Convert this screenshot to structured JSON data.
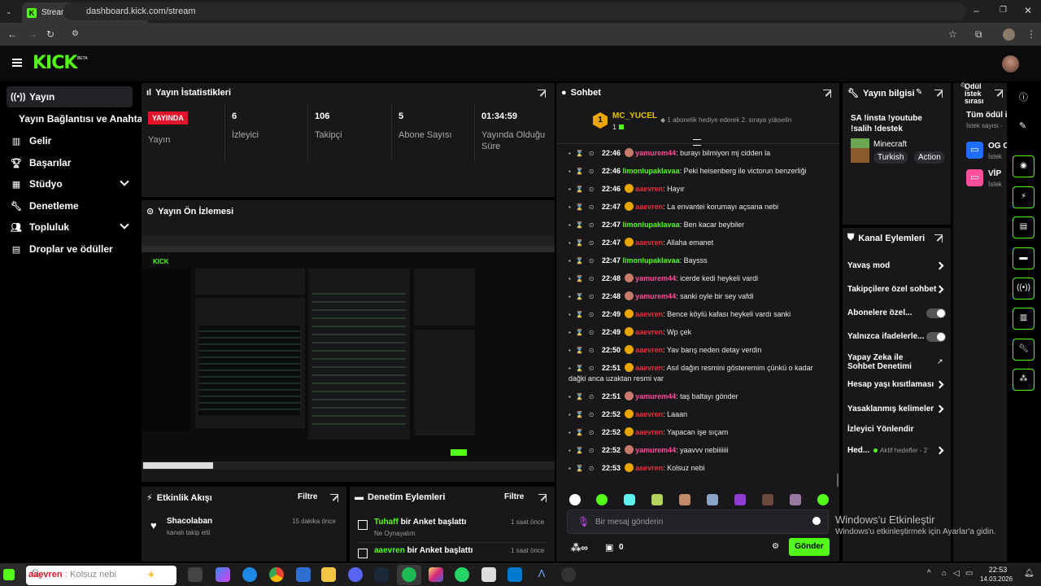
{
  "browser": {
    "tab_title": "Stream - Kick Dashboard",
    "url": "dashboard.kick.com/stream"
  },
  "header": {
    "logo": "KICK",
    "beta": "BETA"
  },
  "sidebar": {
    "items": [
      {
        "label": "Yayın",
        "icon": "broadcast-icon"
      },
      {
        "label": "Yayın Bağlantısı ve Anahtarı",
        "icon": ""
      },
      {
        "label": "Gelir",
        "icon": "chart-icon"
      },
      {
        "label": "Başarılar",
        "icon": "trophy-icon"
      },
      {
        "label": "Stüdyo",
        "icon": "studio-icon"
      },
      {
        "label": "Denetleme",
        "icon": "wrench-icon"
      },
      {
        "label": "Topluluk",
        "icon": "users-icon"
      },
      {
        "label": "Droplar ve ödüller",
        "icon": "gift-icon"
      }
    ]
  },
  "stats": {
    "title": "Yayın İstatistikleri",
    "live_badge": "YAYINDA",
    "live_label": "Yayın",
    "viewers_value": "6",
    "viewers_label": "İzleyici",
    "followers_value": "106",
    "followers_label": "Takipçi",
    "subs_value": "5",
    "subs_label": "Abone Sayısı",
    "uptime_value": "01:34:59",
    "uptime_label": "Yayında Olduğu Süre"
  },
  "preview": {
    "title": "Yayın Ön İzlemesi"
  },
  "activity": {
    "title": "Etkinlik Akışı",
    "filter": "Filtre",
    "item_user": "Shacolaban",
    "item_desc": "kanalı takip etti",
    "item_time": "15 dakika önce"
  },
  "moderation": {
    "title": "Denetim Eylemleri",
    "filter": "Filtre",
    "items": [
      {
        "user": "Tuhaff",
        "action": " bir Anket başlattı",
        "sub": "Ne Oynayalım",
        "time": "1 saat önce"
      },
      {
        "user": "aaevren",
        "action": " bir Anket başlattı",
        "sub": "",
        "time": "1 saat önce"
      }
    ]
  },
  "chat": {
    "title": "Sohbet",
    "pinned_user": "MC_YUCEL",
    "pinned_count": "1",
    "pinned_note": "1 abonelik hediye ederek 2. sıraya yükselin",
    "messages": [
      {
        "time": "22:46",
        "user": "yamurem44",
        "cls": "u-yamurem",
        "text": ": burayı bilmiyon mj cidden la"
      },
      {
        "time": "22:46",
        "user": "limonlupaklavaa",
        "cls": "u-limon",
        "text": ": Peki heisenberg ile victorun benzerliği"
      },
      {
        "time": "22:46",
        "user": "aaevren",
        "cls": "u-aaevren",
        "text": ": Hayır"
      },
      {
        "time": "22:47",
        "user": "aaevren",
        "cls": "u-aaevren",
        "text": ": La envantei korumayı açsana nebi"
      },
      {
        "time": "22:47",
        "user": "limonlupaklavaa",
        "cls": "u-limon",
        "text": ": Ben kacar beybiler"
      },
      {
        "time": "22:47",
        "user": "aaevren",
        "cls": "u-aaevren",
        "text": ": Allaha emanet"
      },
      {
        "time": "22:47",
        "user": "limonlupaklavaa",
        "cls": "u-limon",
        "text": ": Baysss"
      },
      {
        "time": "22:48",
        "user": "yamurem44",
        "cls": "u-yamurem",
        "text": ": icerde kedi heykeli vardi"
      },
      {
        "time": "22:48",
        "user": "yamurem44",
        "cls": "u-yamurem",
        "text": ": sanki oyle bir sey vafdi"
      },
      {
        "time": "22:49",
        "user": "aaevren",
        "cls": "u-aaevren",
        "text": ": Bence köylü kafası heykeli vardı sanki"
      },
      {
        "time": "22:49",
        "user": "aaevren",
        "cls": "u-aaevren",
        "text": ": Wp çek"
      },
      {
        "time": "22:50",
        "user": "aaevren",
        "cls": "u-aaevren",
        "text": ": Yav barış neden detay verdin"
      },
      {
        "time": "22:51",
        "user": "aaevren",
        "cls": "u-aaevren",
        "text": ": Asıl dağın resmini gösteremim çünkü o kadar dağki anca uzaktan resmi var"
      },
      {
        "time": "22:51",
        "user": "yamurem44",
        "cls": "u-yamurem",
        "text": ": taş baltayı gönder"
      },
      {
        "time": "22:52",
        "user": "aaevren",
        "cls": "u-aaevren",
        "text": ": Laaan"
      },
      {
        "time": "22:52",
        "user": "aaevren",
        "cls": "u-aaevren",
        "text": ": Yapacan işe sıçam"
      },
      {
        "time": "22:52",
        "user": "yamurem44",
        "cls": "u-yamurem",
        "text": ": yaavvv nebiiiiiii"
      },
      {
        "time": "22:53",
        "user": "aaevren",
        "cls": "u-aaevren",
        "text": ": Kolsuz nebi"
      }
    ],
    "input_placeholder": "Bir mesaj gönderin",
    "points": "0",
    "send": "Gönder"
  },
  "stream_info": {
    "title": "Yayın bilgisi",
    "stream_title": "SA !insta !youtube !salih !destek",
    "category": "Minecraft",
    "tags": [
      "Turkish",
      "Action"
    ]
  },
  "channel_actions": {
    "title": "Kanal Eylemleri",
    "slow_mode": "Yavaş mod",
    "followers_only": "Takipçilere özel sohbet",
    "subs_only": "Abonelere özel...",
    "emotes_only": "Yalnızca ifadelerle...",
    "ai_mod": "Yapay Zeka ile Sohbet Denetimi",
    "account_age": "Hesap yaşı kısıtlaması",
    "banned_words": "Yasaklanmış kelimeler",
    "viewer_redirect": "İzleyici Yönlendir",
    "goals": "Hed...",
    "goals_note": "Aktif hedefler - 2"
  },
  "rewards": {
    "title": "Ödül istek sırası",
    "all_label": "Tüm ödül i",
    "all_sub": "İstek sayısı -",
    "items": [
      {
        "label": "OG C",
        "sub": "İstek"
      },
      {
        "label": "VİP",
        "sub": "İstek"
      }
    ]
  },
  "windows": {
    "activate_title": "Windows'u Etkinleştir",
    "activate_sub": "Windows'u etkinleştirmek için Ayarlar'a gidin.",
    "clock_time": "22:53",
    "clock_date": "14.03.2026",
    "notif_user": "aaevren",
    "notif_text": ": Kolsuz nebi"
  },
  "colors": {
    "accent": "#53fc18",
    "panel": "#18181b",
    "live": "#e3132a"
  }
}
